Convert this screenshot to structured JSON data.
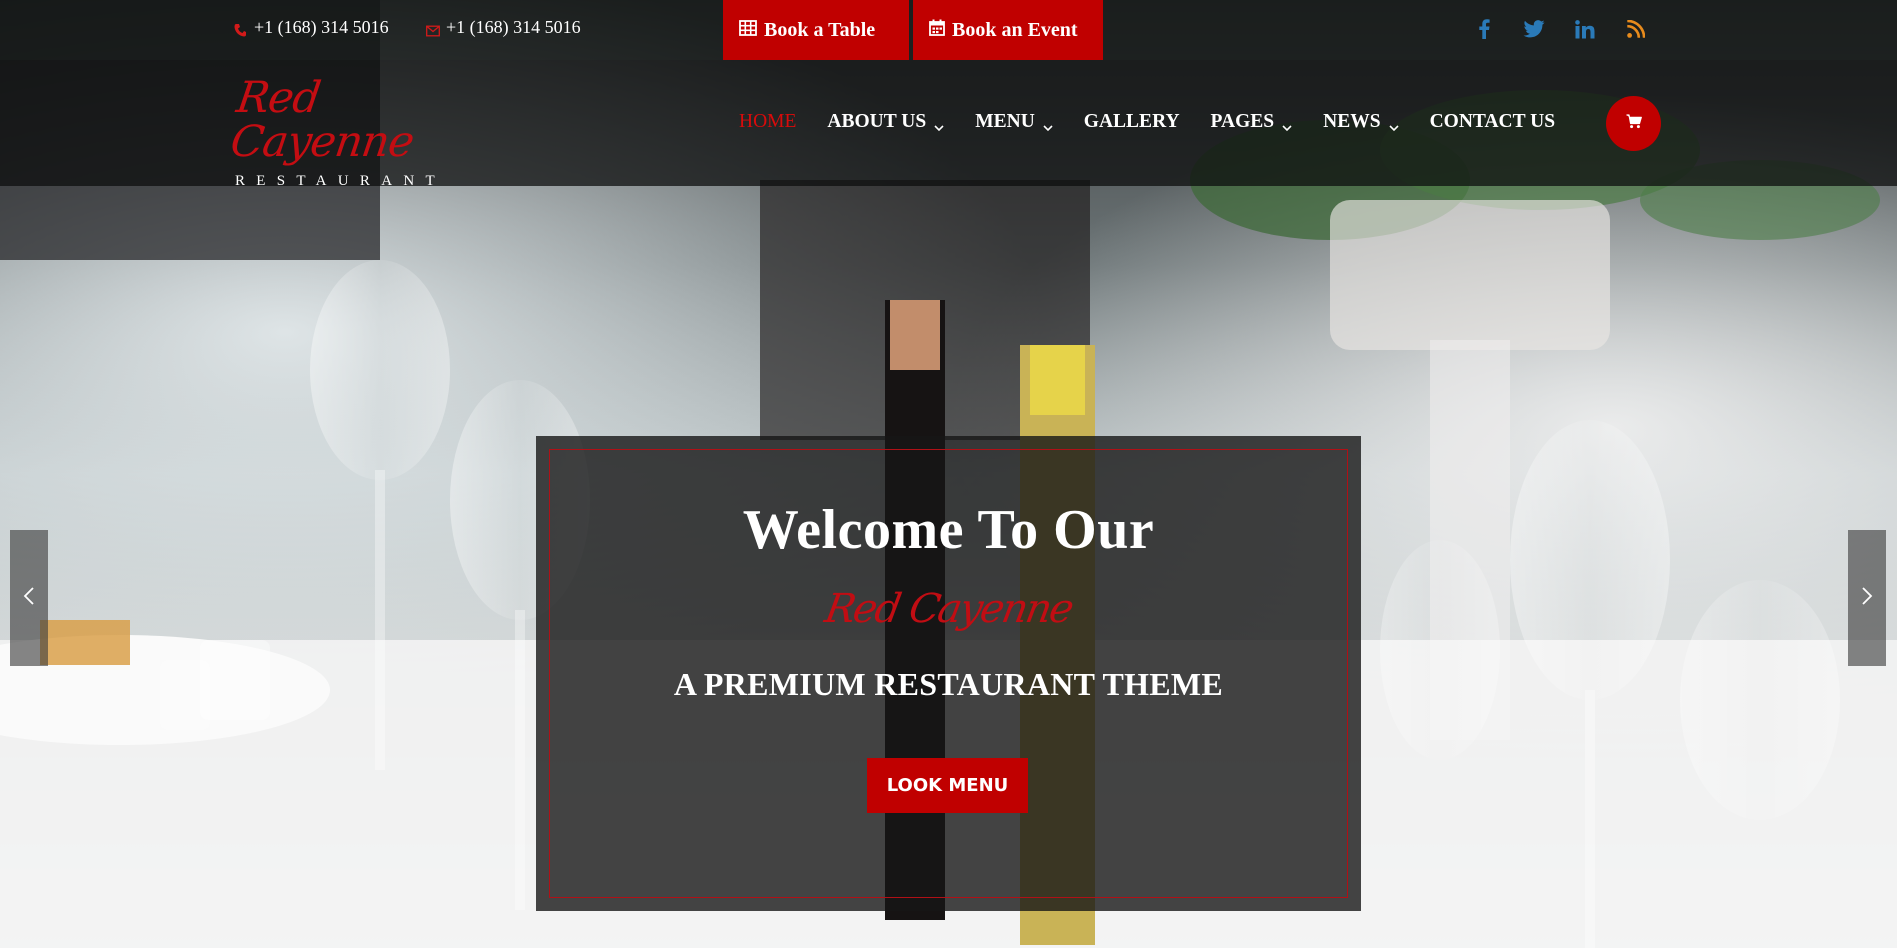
{
  "topbar": {
    "phone": "+1 (168) 314 5016",
    "email": "+1 (168) 314 5016",
    "book_table_label": "Book a Table",
    "book_event_label": "Book an Event",
    "social": [
      "facebook-icon",
      "twitter-icon",
      "linkedin-icon",
      "rss-icon"
    ]
  },
  "logo": {
    "script": "Red Cayenne",
    "sub": "RESTAURANT"
  },
  "nav": {
    "items": [
      {
        "label": "HOME",
        "active": true,
        "has_dropdown": false
      },
      {
        "label": "ABOUT US",
        "active": false,
        "has_dropdown": true
      },
      {
        "label": "MENU",
        "active": false,
        "has_dropdown": true
      },
      {
        "label": "GALLERY",
        "active": false,
        "has_dropdown": false
      },
      {
        "label": "PAGES",
        "active": false,
        "has_dropdown": true
      },
      {
        "label": "NEWS",
        "active": false,
        "has_dropdown": true
      },
      {
        "label": "CONTACT US",
        "active": false,
        "has_dropdown": false
      }
    ],
    "cart_icon": "shopping-cart-icon"
  },
  "hero": {
    "title": "Welcome To Our",
    "script": "Red Cayenne",
    "subtitle": "A PREMIUM RESTAURANT THEME",
    "button_label": "LOOK MENU"
  },
  "slider": {
    "prev_icon": "chevron-left-icon",
    "next_icon": "chevron-right-icon"
  },
  "colors": {
    "accent": "#c00000",
    "nav_active": "#d80b0b",
    "social_blue": "#2a7ab8",
    "rss_orange": "#e88b1c"
  }
}
